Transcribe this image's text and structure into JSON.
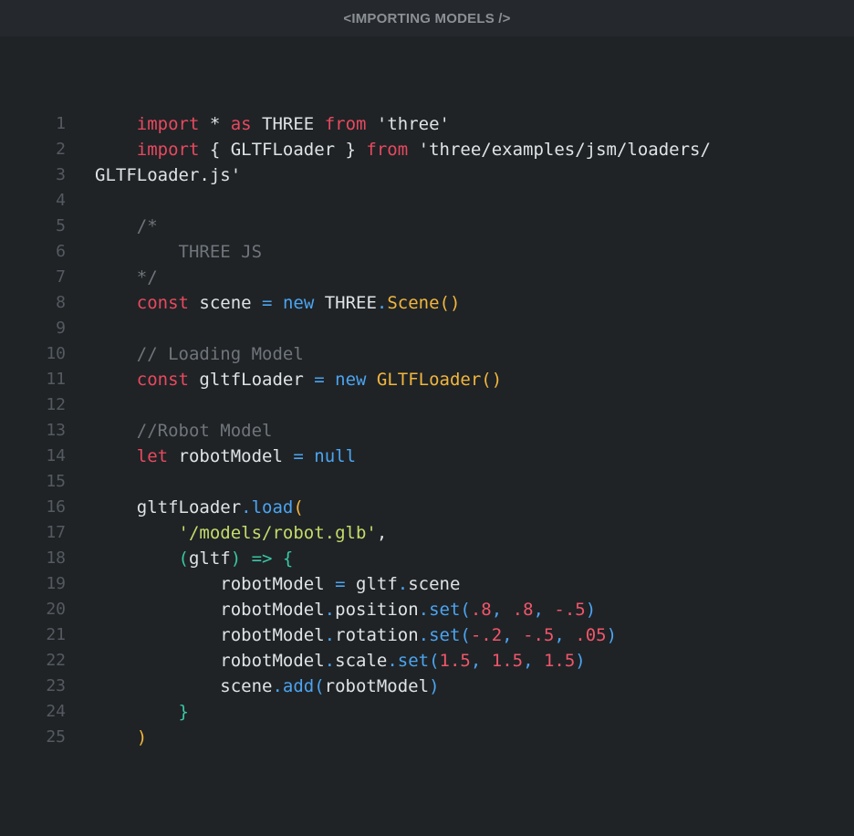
{
  "window": {
    "title": "<IMPORTING MODELS />"
  },
  "editor": {
    "lines": [
      {
        "n": "1",
        "t": [
          [
            "kw",
            "    import"
          ],
          [
            "tx",
            " * "
          ],
          [
            "kw",
            "as"
          ],
          [
            "tx",
            " THREE "
          ],
          [
            "kw",
            "from"
          ],
          [
            "tx",
            " 'three'"
          ]
        ]
      },
      {
        "n": "2",
        "t": [
          [
            "kw",
            "    import"
          ],
          [
            "tx",
            " { GLTFLoader } "
          ],
          [
            "kw",
            "from"
          ],
          [
            "tx",
            " 'three/examples/jsm/loaders/"
          ]
        ]
      },
      {
        "n": "3",
        "t": [
          [
            "tx",
            "GLTFLoader.js'"
          ]
        ]
      },
      {
        "n": "4",
        "t": []
      },
      {
        "n": "5",
        "t": [
          [
            "cm",
            "    /*"
          ]
        ]
      },
      {
        "n": "6",
        "t": [
          [
            "cm",
            "        THREE JS"
          ]
        ]
      },
      {
        "n": "7",
        "t": [
          [
            "cm",
            "    */"
          ]
        ]
      },
      {
        "n": "8",
        "t": [
          [
            "kw",
            "    const"
          ],
          [
            "tx",
            " scene "
          ],
          [
            "kwb",
            "="
          ],
          [
            "tx",
            " "
          ],
          [
            "kwb",
            "new"
          ],
          [
            "tx",
            " THREE"
          ],
          [
            "kwb",
            "."
          ],
          [
            "fn",
            "Scene()"
          ]
        ]
      },
      {
        "n": "9",
        "t": []
      },
      {
        "n": "10",
        "t": [
          [
            "cm",
            "    // Loading Model"
          ]
        ]
      },
      {
        "n": "11",
        "t": [
          [
            "kw",
            "    const"
          ],
          [
            "tx",
            " gltfLoader "
          ],
          [
            "kwb",
            "="
          ],
          [
            "tx",
            " "
          ],
          [
            "kwb",
            "new"
          ],
          [
            "tx",
            " "
          ],
          [
            "fn",
            "GLTFLoader()"
          ]
        ]
      },
      {
        "n": "12",
        "t": []
      },
      {
        "n": "13",
        "t": [
          [
            "cm",
            "    //Robot Model"
          ]
        ]
      },
      {
        "n": "14",
        "t": [
          [
            "kw",
            "    let"
          ],
          [
            "tx",
            " robotModel "
          ],
          [
            "kwb",
            "="
          ],
          [
            "tx",
            " "
          ],
          [
            "kwb",
            "null"
          ]
        ]
      },
      {
        "n": "15",
        "t": []
      },
      {
        "n": "16",
        "t": [
          [
            "tx",
            "    gltfLoader"
          ],
          [
            "kwb",
            ".load"
          ],
          [
            "fn",
            "("
          ]
        ]
      },
      {
        "n": "17",
        "t": [
          [
            "str",
            "        '/models/robot.glb'"
          ],
          [
            "tx",
            ","
          ]
        ]
      },
      {
        "n": "18",
        "t": [
          [
            "pc",
            "        ("
          ],
          [
            "tx",
            "gltf"
          ],
          [
            "pc",
            ") => {"
          ]
        ]
      },
      {
        "n": "19",
        "t": [
          [
            "tx",
            "            robotModel "
          ],
          [
            "kwb",
            "="
          ],
          [
            "tx",
            " gltf"
          ],
          [
            "kwb",
            "."
          ],
          [
            "tx",
            "scene"
          ]
        ]
      },
      {
        "n": "20",
        "t": [
          [
            "tx",
            "            robotModel"
          ],
          [
            "kwb",
            "."
          ],
          [
            "tx",
            "position"
          ],
          [
            "kwb",
            ".set("
          ],
          [
            "num",
            ".8"
          ],
          [
            "pb",
            ", "
          ],
          [
            "num",
            ".8"
          ],
          [
            "pb",
            ", "
          ],
          [
            "num",
            "-.5"
          ],
          [
            "pb",
            ")"
          ]
        ]
      },
      {
        "n": "21",
        "t": [
          [
            "tx",
            "            robotModel"
          ],
          [
            "kwb",
            "."
          ],
          [
            "tx",
            "rotation"
          ],
          [
            "kwb",
            ".set("
          ],
          [
            "num",
            "-.2"
          ],
          [
            "pb",
            ", "
          ],
          [
            "num",
            "-.5"
          ],
          [
            "pb",
            ", "
          ],
          [
            "num",
            ".05"
          ],
          [
            "pb",
            ")"
          ]
        ]
      },
      {
        "n": "22",
        "t": [
          [
            "tx",
            "            robotModel"
          ],
          [
            "kwb",
            "."
          ],
          [
            "tx",
            "scale"
          ],
          [
            "kwb",
            ".set("
          ],
          [
            "num",
            "1.5"
          ],
          [
            "pb",
            ", "
          ],
          [
            "num",
            "1.5"
          ],
          [
            "pb",
            ", "
          ],
          [
            "num",
            "1.5"
          ],
          [
            "pb",
            ")"
          ]
        ]
      },
      {
        "n": "23",
        "t": [
          [
            "tx",
            "            scene"
          ],
          [
            "kwb",
            ".add("
          ],
          [
            "tx",
            "robotModel"
          ],
          [
            "kwb",
            ")"
          ]
        ]
      },
      {
        "n": "24",
        "t": [
          [
            "pc",
            "        }"
          ]
        ]
      },
      {
        "n": "25",
        "t": [
          [
            "fn",
            "    )"
          ]
        ]
      }
    ]
  }
}
